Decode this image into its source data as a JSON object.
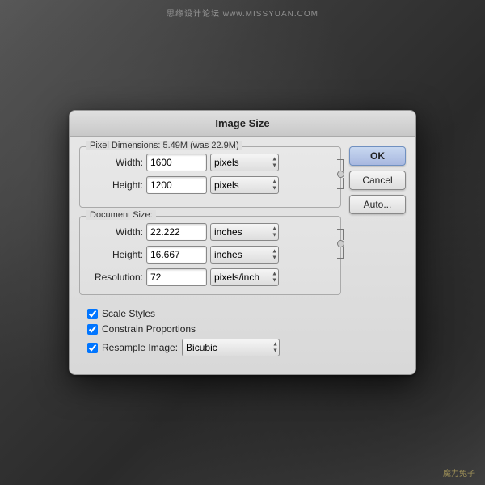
{
  "watermark": {
    "top_text": "思缘设计论坛  www.MISSYUAN.COM",
    "bottom_text": "魔力兔子"
  },
  "dialog": {
    "title": "Image Size",
    "pixel_dimensions": {
      "label": "Pixel Dimensions:",
      "size_info": "5.49M (was 22.9M)",
      "width_label": "Width:",
      "width_value": "1600",
      "height_label": "Height:",
      "height_value": "1200",
      "unit_pixels": "pixels"
    },
    "document_size": {
      "label": "Document Size:",
      "width_label": "Width:",
      "width_value": "22.222",
      "height_label": "Height:",
      "height_value": "16.667",
      "resolution_label": "Resolution:",
      "resolution_value": "72",
      "unit_inches": "inches",
      "unit_pixels_inch": "pixels/inch"
    },
    "buttons": {
      "ok": "OK",
      "cancel": "Cancel",
      "auto": "Auto..."
    },
    "checkboxes": {
      "scale_styles": "Scale Styles",
      "scale_styles_checked": true,
      "constrain_proportions": "Constrain Proportions",
      "constrain_checked": true,
      "resample_image": "Resample Image:",
      "resample_checked": true,
      "resample_method": "Bicubic"
    }
  }
}
